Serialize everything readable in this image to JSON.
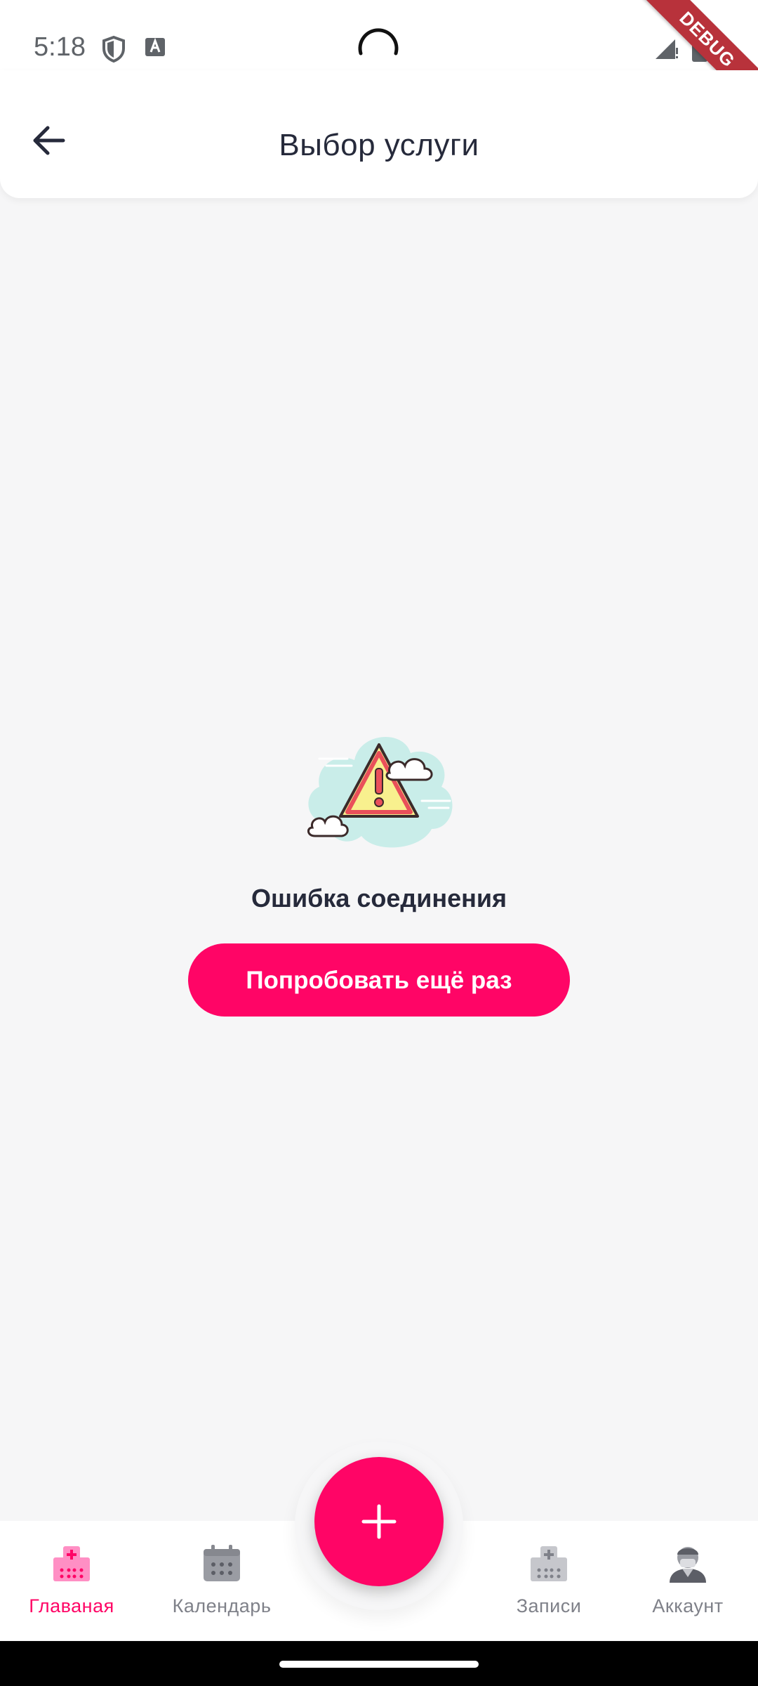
{
  "status_bar": {
    "time": "5:18",
    "debug_label": "DEBUG",
    "icons": [
      "shield-icon",
      "keyboard-icon",
      "signal-icon",
      "battery-icon"
    ]
  },
  "header": {
    "back_icon": "arrow-left-icon",
    "title": "Выбор услуги"
  },
  "error": {
    "illustration": "warning-cloud-icon",
    "message": "Ошибка соединения",
    "retry_label": "Попробовать ещё раз"
  },
  "bottom_nav": {
    "items": [
      {
        "label": "Главаная",
        "icon": "hospital-icon",
        "active": true
      },
      {
        "label": "Календарь",
        "icon": "calendar-icon",
        "active": false
      },
      {
        "label": "Записи",
        "icon": "clinic-icon",
        "active": false
      },
      {
        "label": "Аккаунт",
        "icon": "doctor-avatar-icon",
        "active": false
      }
    ],
    "fab_icon": "plus-icon"
  },
  "colors": {
    "accent": "#ff0566",
    "background": "#f6f6f7",
    "text": "#262a3b",
    "inactive": "#7f8189"
  }
}
